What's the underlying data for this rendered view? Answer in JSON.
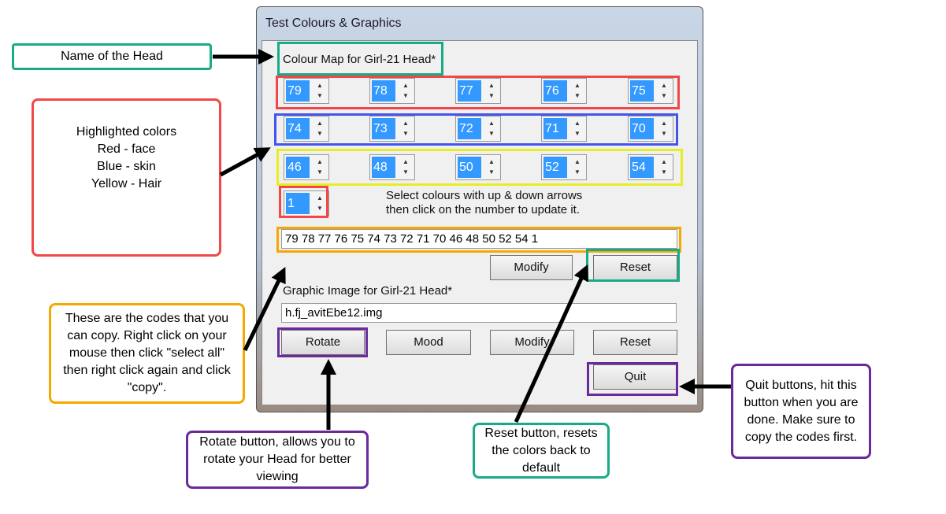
{
  "window": {
    "title": "Test Colours & Graphics"
  },
  "colour_map": {
    "label": "Colour Map for Girl-21 Head*",
    "rows": [
      [
        "79",
        "78",
        "77",
        "76",
        "75"
      ],
      [
        "74",
        "73",
        "72",
        "71",
        "70"
      ],
      [
        "46",
        "48",
        "50",
        "52",
        "54"
      ]
    ],
    "extra": "1",
    "instructions": [
      "Select colours with up & down arrows",
      "then click on the number to update it."
    ],
    "codes": "79 78 77 76 75 74 73 72 71 70 46 48 50 52 54 1",
    "modify": "Modify",
    "reset": "Reset"
  },
  "graphic": {
    "label": "Graphic Image for Girl-21 Head*",
    "file": "h.fj_avitEbe12.img",
    "rotate": "Rotate",
    "mood": "Mood",
    "modify": "Modify",
    "reset": "Reset",
    "quit": "Quit"
  },
  "annotations": {
    "name": "Name of the Head",
    "colors": [
      "Highlighted colors",
      "Red - face",
      "Blue - skin",
      "Yellow - Hair"
    ],
    "codes": "These are the codes that you can copy. Right click on your mouse then click \"select all\" then right click again and click \"copy\".",
    "rotate": "Rotate button, allows you to rotate your Head for better viewing",
    "reset": "Reset button, resets the colors back to default",
    "quit": "Quit buttons, hit this button when you are done. Make sure to copy the codes first."
  },
  "colors": {
    "red": "#f04848",
    "blue": "#4455ee",
    "yellow": "#e6ee22",
    "orange": "#f5a800",
    "teal": "#1aaa88",
    "purple": "#6a2a9a",
    "selection": "#3399ff"
  }
}
